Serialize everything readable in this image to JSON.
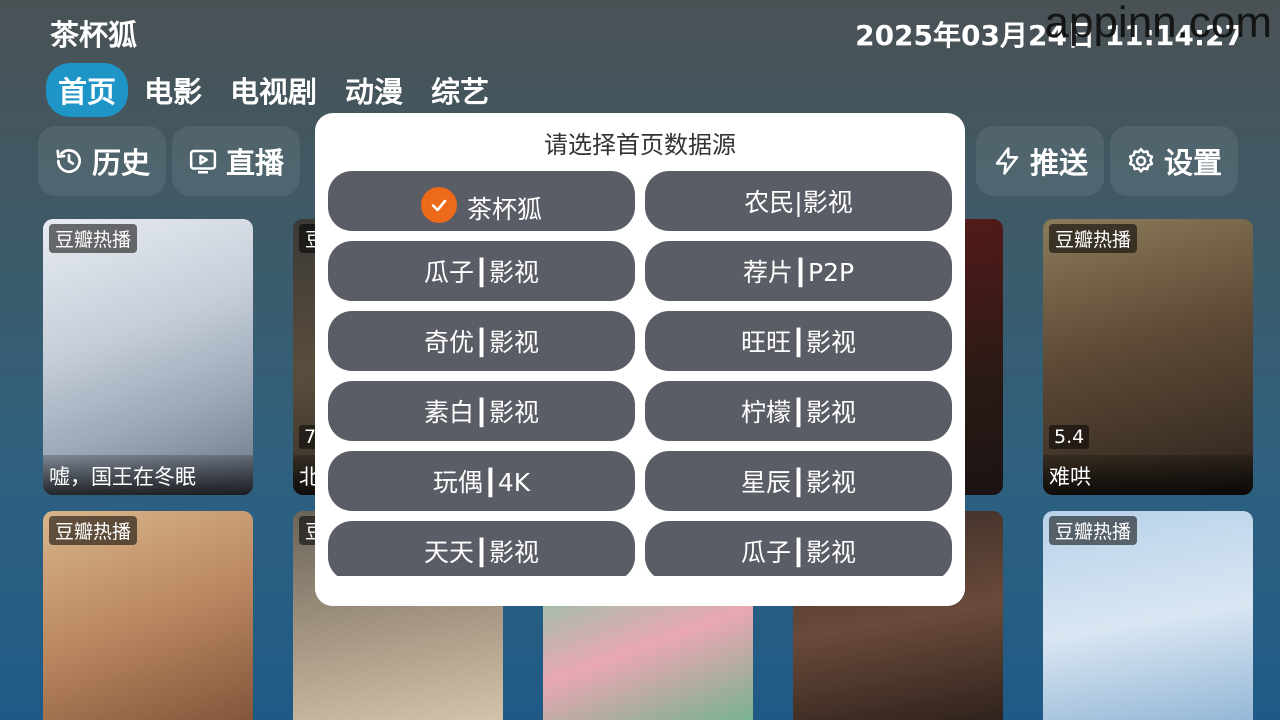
{
  "header": {
    "app_title": "茶杯狐",
    "clock": "2025年03月24日 11:14:27",
    "watermark": "appinn.com"
  },
  "tabs": [
    {
      "label": "首页",
      "active": true
    },
    {
      "label": "电影"
    },
    {
      "label": "电视剧"
    },
    {
      "label": "动漫"
    },
    {
      "label": "综艺"
    }
  ],
  "toolbar": {
    "history": "历史",
    "live": "直播",
    "push": "推送",
    "settings": "设置"
  },
  "posters": [
    {
      "badge": "豆瓣热播",
      "caption": "嘘，国王在冬眠",
      "score": ""
    },
    {
      "badge": "豆",
      "caption": "北",
      "score": "7."
    },
    {
      "badge": "豆瓣热播",
      "caption": "难哄",
      "score": "5.4"
    },
    {
      "badge": "豆瓣热播",
      "caption": "",
      "score": ""
    },
    {
      "badge": "豆",
      "caption": "",
      "score": ""
    },
    {
      "badge": "豆瓣热播",
      "caption": "",
      "score": ""
    }
  ],
  "dialog": {
    "title": "请选择首页数据源",
    "options": [
      {
        "label": "茶杯狐",
        "selected": true
      },
      {
        "label": "农民|影视"
      },
      {
        "label": "瓜子┃影视"
      },
      {
        "label": "荐片┃P2P"
      },
      {
        "label": "奇优┃影视"
      },
      {
        "label": "旺旺┃影视"
      },
      {
        "label": "素白┃影视"
      },
      {
        "label": "柠檬┃影视"
      },
      {
        "label": "玩偶┃4K"
      },
      {
        "label": "星辰┃影视"
      },
      {
        "label": "天天┃影视"
      },
      {
        "label": "瓜子┃影视"
      }
    ]
  },
  "colors": {
    "accent": "#1e94c7",
    "option_bg": "#5b5d66",
    "check": "#ee6a1b"
  }
}
